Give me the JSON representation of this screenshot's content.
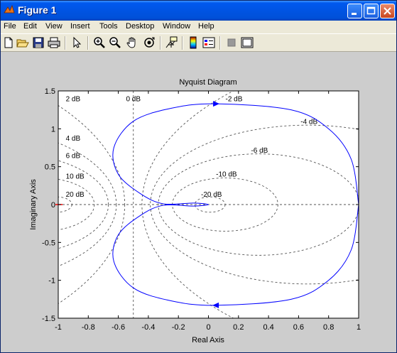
{
  "window": {
    "title": "Figure 1",
    "colors": {
      "titlebar": "#0054e3",
      "background": "#cdcdcd"
    }
  },
  "menubar": {
    "items": [
      "File",
      "Edit",
      "View",
      "Insert",
      "Tools",
      "Desktop",
      "Window",
      "Help"
    ]
  },
  "toolbar": {
    "tools": [
      "new-figure-icon",
      "open-file-icon",
      "save-icon",
      "print-icon",
      "select-arrow-icon",
      "zoom-in-icon",
      "zoom-out-icon",
      "pan-hand-icon",
      "rotate-3d-icon",
      "data-cursor-icon",
      "colorbar-icon",
      "legend-icon",
      "hide-plot-tools-icon",
      "show-plot-tools-icon"
    ]
  },
  "chart_data": {
    "type": "line",
    "title": "Nyquist Diagram",
    "xlabel": "Real Axis",
    "ylabel": "Imaginary Axis",
    "xlim": [
      -1,
      1
    ],
    "ylim": [
      -1.5,
      1.5
    ],
    "xticks": [
      -1,
      -0.8,
      -0.6,
      -0.4,
      -0.2,
      0,
      0.2,
      0.4,
      0.6,
      0.8,
      1
    ],
    "yticks": [
      -1.5,
      -1,
      -0.5,
      0,
      0.5,
      1,
      1.5
    ],
    "xtick_labels": [
      "-1",
      "-0.8",
      "-0.6",
      "-0.4",
      "-0.2",
      "0",
      "0.2",
      "0.4",
      "0.6",
      "0.8",
      "1"
    ],
    "ytick_labels": [
      "-1.5",
      "-1",
      "-0.5",
      "0",
      "0.5",
      "1",
      "1.5"
    ],
    "grid": "M-circles",
    "m_circle_labels": [
      "0 dB",
      "2 dB",
      "-2 dB",
      "4 dB",
      "-4 dB",
      "6 dB",
      "-6 dB",
      "10 dB",
      "-10 dB",
      "20 dB",
      "-20 dB"
    ],
    "m_circle_db": [
      0,
      2,
      -2,
      4,
      -4,
      6,
      -6,
      10,
      -10,
      20,
      -20
    ],
    "series": [
      {
        "color": "#0000ff",
        "points": [
          [
            1.0,
            0.0
          ],
          [
            0.95,
            0.6
          ],
          [
            0.8,
            1.0
          ],
          [
            0.55,
            1.25
          ],
          [
            0.05,
            1.33
          ],
          [
            -0.25,
            1.27
          ],
          [
            -0.5,
            1.1
          ],
          [
            -0.63,
            0.75
          ],
          [
            -0.6,
            0.4
          ],
          [
            -0.45,
            0.14
          ],
          [
            -0.3,
            0.01
          ],
          [
            -0.1,
            0.02
          ],
          [
            0.0,
            0.0
          ],
          [
            -0.1,
            -0.02
          ],
          [
            -0.3,
            -0.01
          ],
          [
            -0.45,
            -0.14
          ],
          [
            -0.6,
            -0.4
          ],
          [
            -0.63,
            -0.75
          ],
          [
            -0.5,
            -1.1
          ],
          [
            -0.25,
            -1.27
          ],
          [
            0.05,
            -1.33
          ],
          [
            0.55,
            -1.25
          ],
          [
            0.8,
            -1.0
          ],
          [
            0.95,
            -0.6
          ],
          [
            1.0,
            0.0
          ]
        ]
      }
    ],
    "critical_point": [
      -1,
      0
    ]
  }
}
